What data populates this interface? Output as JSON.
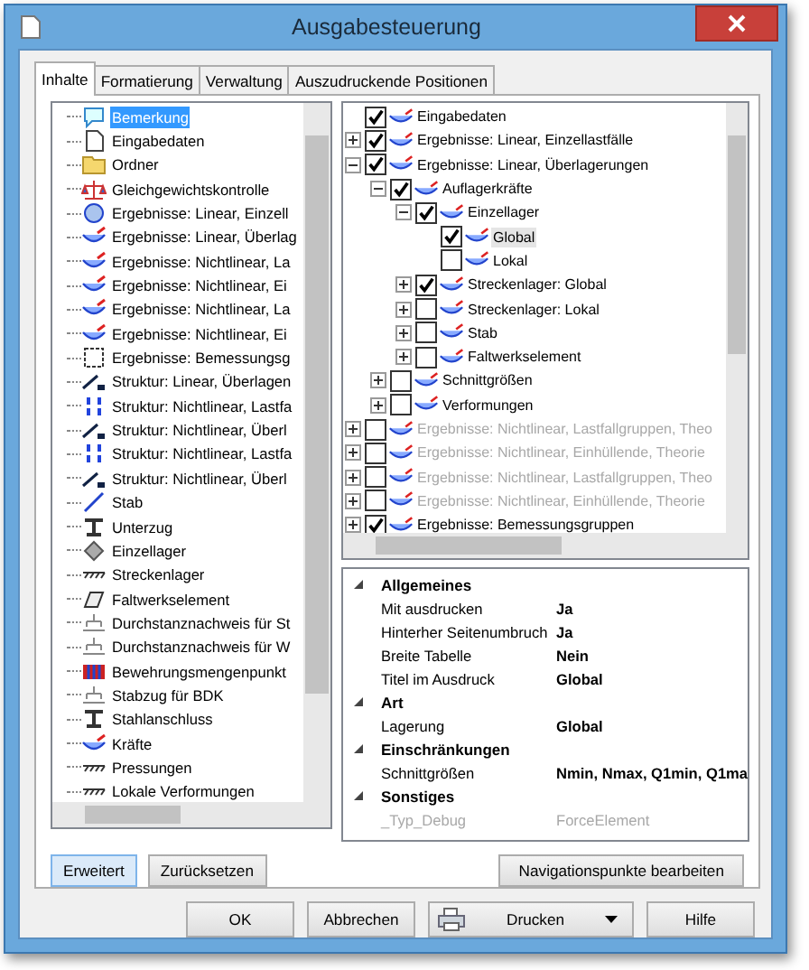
{
  "window": {
    "title": "Ausgabesteuerung"
  },
  "tabs": [
    {
      "label": "Inhalte",
      "selected": true
    },
    {
      "label": "Formatierung",
      "selected": false
    },
    {
      "label": "Verwaltung",
      "selected": false
    },
    {
      "label": "Auszudruckende Positionen",
      "selected": false
    }
  ],
  "palette": [
    {
      "label": "Bemerkung",
      "selected": true
    },
    {
      "label": "Eingabedaten",
      "selected": false
    },
    {
      "label": "Ordner",
      "selected": false
    },
    {
      "label": "Gleichgewichtskontrolle",
      "selected": false
    },
    {
      "label": "Ergebnisse: Linear, Einzell",
      "selected": false
    },
    {
      "label": "Ergebnisse: Linear, Überlag",
      "selected": false
    },
    {
      "label": "Ergebnisse: Nichtlinear, La",
      "selected": false
    },
    {
      "label": "Ergebnisse: Nichtlinear, Ei",
      "selected": false
    },
    {
      "label": "Ergebnisse: Nichtlinear, La",
      "selected": false
    },
    {
      "label": "Ergebnisse: Nichtlinear, Ei",
      "selected": false
    },
    {
      "label": "Ergebnisse: Bemessungsg",
      "selected": false
    },
    {
      "label": "Struktur: Linear, Überlagen",
      "selected": false
    },
    {
      "label": "Struktur: Nichtlinear, Lastfa",
      "selected": false
    },
    {
      "label": "Struktur: Nichtlinear, Überl",
      "selected": false
    },
    {
      "label": "Struktur: Nichtlinear, Lastfa",
      "selected": false
    },
    {
      "label": "Struktur: Nichtlinear, Überl",
      "selected": false
    },
    {
      "label": "Stab",
      "selected": false
    },
    {
      "label": "Unterzug",
      "selected": false
    },
    {
      "label": "Einzellager",
      "selected": false
    },
    {
      "label": "Streckenlager",
      "selected": false
    },
    {
      "label": "Faltwerkselement",
      "selected": false
    },
    {
      "label": "Durchstanznachweis für St",
      "selected": false
    },
    {
      "label": "Durchstanznachweis für W",
      "selected": false
    },
    {
      "label": "Bewehrungsmengenpunkt",
      "selected": false
    },
    {
      "label": "Stabzug für BDK",
      "selected": false
    },
    {
      "label": "Stahlanschluss",
      "selected": false
    },
    {
      "label": "Kräfte",
      "selected": false
    },
    {
      "label": "Pressungen",
      "selected": false
    },
    {
      "label": "Lokale Verformungen",
      "selected": false
    }
  ],
  "tree": [
    {
      "label": "Eingabedaten",
      "checked": true,
      "disabled": false,
      "selected": false
    },
    {
      "label": "Ergebnisse: Linear, Einzellastfälle",
      "checked": true,
      "disabled": false,
      "selected": false,
      "expanded": false
    },
    {
      "label": "Ergebnisse: Linear, Überlagerungen",
      "checked": true,
      "disabled": false,
      "selected": false,
      "expanded": true,
      "children": [
        {
          "label": "Auflagerkräfte",
          "checked": true,
          "disabled": false,
          "selected": false,
          "expanded": true,
          "children": [
            {
              "label": "Einzellager",
              "checked": true,
              "disabled": false,
              "selected": false,
              "expanded": true,
              "children": [
                {
                  "label": "Global",
                  "checked": true,
                  "disabled": false,
                  "selected": true
                },
                {
                  "label": "Lokal",
                  "checked": false,
                  "disabled": false,
                  "selected": false
                }
              ]
            },
            {
              "label": "Streckenlager: Global",
              "checked": true,
              "disabled": false,
              "selected": false,
              "expanded": false
            },
            {
              "label": "Streckenlager: Lokal",
              "checked": false,
              "disabled": false,
              "selected": false,
              "expanded": false
            },
            {
              "label": "Stab",
              "checked": false,
              "disabled": false,
              "selected": false,
              "expanded": false
            },
            {
              "label": "Faltwerkselement",
              "checked": false,
              "disabled": false,
              "selected": false,
              "expanded": false
            }
          ]
        },
        {
          "label": "Schnittgrößen",
          "checked": false,
          "disabled": false,
          "selected": false,
          "expanded": false
        },
        {
          "label": "Verformungen",
          "checked": false,
          "disabled": false,
          "selected": false,
          "expanded": false
        }
      ]
    },
    {
      "label": "Ergebnisse: Nichtlinear, Lastfallgruppen, Theo",
      "checked": false,
      "disabled": true,
      "selected": false,
      "expanded": false
    },
    {
      "label": "Ergebnisse: Nichtlinear, Einhüllende, Theorie",
      "checked": false,
      "disabled": true,
      "selected": false,
      "expanded": false
    },
    {
      "label": "Ergebnisse: Nichtlinear, Lastfallgruppen, Theo",
      "checked": false,
      "disabled": true,
      "selected": false,
      "expanded": false
    },
    {
      "label": "Ergebnisse: Nichtlinear, Einhüllende, Theorie",
      "checked": false,
      "disabled": true,
      "selected": false,
      "expanded": false
    },
    {
      "label": "Ergebnisse: Bemessungsgruppen",
      "checked": true,
      "disabled": false,
      "selected": false,
      "expanded": false
    }
  ],
  "properties": [
    {
      "category": "Allgemeines",
      "expanded": true,
      "rows": [
        {
          "name": "Mit ausdrucken",
          "value": "Ja",
          "disabled": false
        },
        {
          "name": "Hinterher Seitenumbruch",
          "value": "Ja",
          "disabled": false
        },
        {
          "name": "Breite Tabelle",
          "value": "Nein",
          "disabled": false
        },
        {
          "name": "Titel im Ausdruck",
          "value": "Global",
          "disabled": false
        }
      ]
    },
    {
      "category": "Art",
      "expanded": true,
      "rows": [
        {
          "name": "Lagerung",
          "value": "Global",
          "disabled": false
        }
      ]
    },
    {
      "category": "Einschränkungen",
      "expanded": true,
      "rows": [
        {
          "name": "Schnittgrößen",
          "value": "Nmin, Nmax, Q1min, Q1ma",
          "disabled": false
        }
      ]
    },
    {
      "category": "Sonstiges",
      "expanded": true,
      "rows": [
        {
          "name": "_Typ_Debug",
          "value": "ForceElement",
          "disabled": true
        }
      ]
    }
  ],
  "panel_buttons": [
    {
      "label": "Erweitert",
      "pressed": true
    },
    {
      "label": "Zurücksetzen",
      "pressed": false
    }
  ],
  "edit_button": "Navigationspunkte bearbeiten",
  "dialog_buttons": {
    "ok": "OK",
    "cancel": "Abbrechen",
    "print": "Drucken",
    "help": "Hilfe"
  }
}
